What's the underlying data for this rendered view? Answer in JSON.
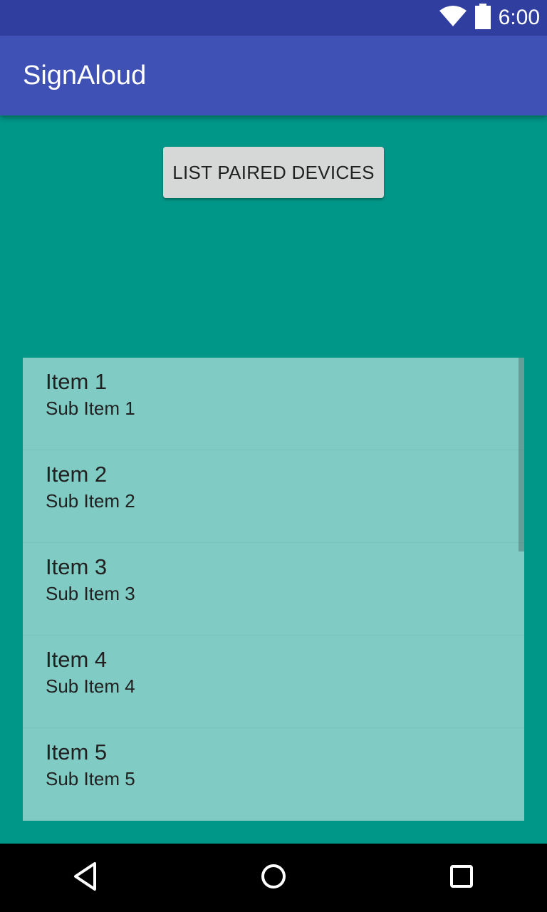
{
  "status_bar": {
    "time": "6:00",
    "icons": [
      "wifi-icon",
      "battery-icon"
    ]
  },
  "app_bar": {
    "title": "SignAloud"
  },
  "content": {
    "list_button_label": "LIST PAIRED DEVICES",
    "items": [
      {
        "title": "Item 1",
        "subtitle": "Sub Item 1"
      },
      {
        "title": "Item 2",
        "subtitle": "Sub Item 2"
      },
      {
        "title": "Item 3",
        "subtitle": "Sub Item 3"
      },
      {
        "title": "Item 4",
        "subtitle": "Sub Item 4"
      },
      {
        "title": "Item 5",
        "subtitle": "Sub Item 5"
      }
    ]
  },
  "nav_bar": {
    "buttons": [
      "back-icon",
      "home-icon",
      "recents-icon"
    ]
  },
  "colors": {
    "status_bar": "#303F9F",
    "app_bar": "#3F51B5",
    "background": "#009688",
    "list_background": "#80CBC4",
    "button": "#D6D7D7"
  }
}
